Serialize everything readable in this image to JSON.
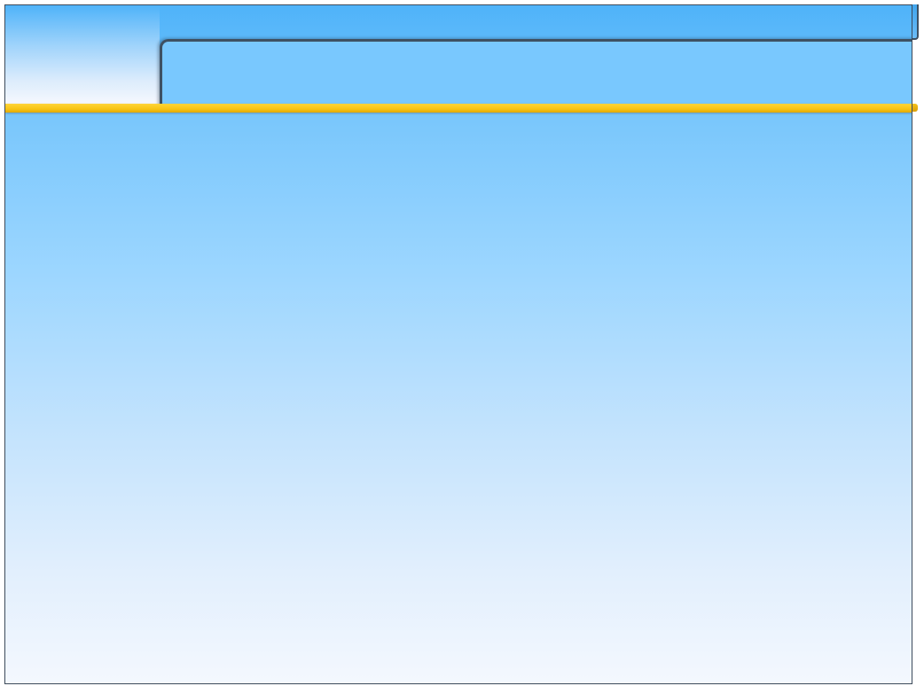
{
  "slide": {
    "title": "",
    "body": ""
  },
  "colors": {
    "accent": "#f8c414",
    "header": "#79c8fe",
    "border": "#3e5163"
  }
}
